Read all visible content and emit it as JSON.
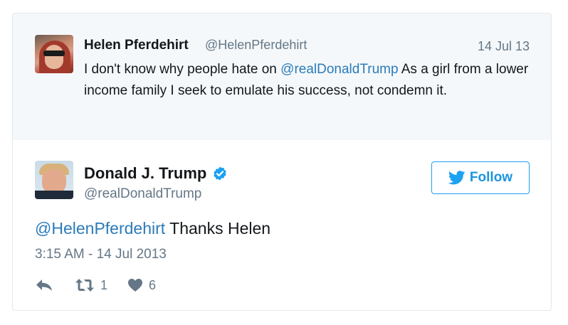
{
  "parent_tweet": {
    "author_name": "Helen Pferdehirt",
    "author_handle": "@HelenPferdehirt",
    "date": "14 Jul 13",
    "text_before": "I don't know why people hate on ",
    "mention": "@realDonaldTrump",
    "text_after": " As a girl from a lower income family I seek to emulate his success, not condemn it."
  },
  "main_tweet": {
    "author_name": "Donald J. Trump",
    "author_handle": "@realDonaldTrump",
    "verified": true,
    "follow_label": "Follow",
    "mention": "@HelenPferdehirt",
    "text": " Thanks Helen",
    "timestamp": "3:15 AM - 14 Jul 2013",
    "retweet_count": "1",
    "like_count": "6"
  },
  "colors": {
    "link": "#2b7bb9",
    "follow_blue": "#1da1f2",
    "muted_text": "#657786",
    "parent_bg": "#f5f8fa"
  },
  "icons": [
    "reply-icon",
    "retweet-icon",
    "heart-icon",
    "twitter-bird-icon",
    "verified-badge-icon"
  ]
}
